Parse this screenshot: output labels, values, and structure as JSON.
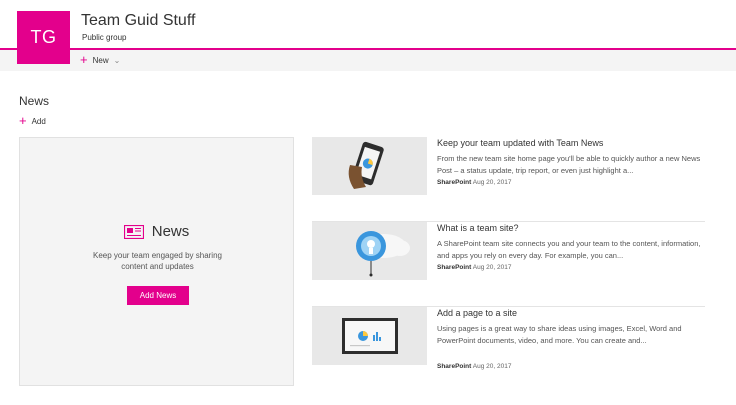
{
  "site": {
    "logo_initials": "TG",
    "title": "Team Guid Stuff",
    "subtitle": "Public group",
    "accent_color": "#e3008c"
  },
  "command_bar": {
    "new_label": "New"
  },
  "news": {
    "heading": "News",
    "add_label": "Add",
    "hero": {
      "icon": "news-icon",
      "title": "News",
      "description": "Keep your team engaged by sharing content and updates",
      "button_label": "Add News"
    },
    "items": [
      {
        "title": "Keep your team updated with Team News",
        "description": "From the new team site home page you'll be able to quickly author a new News Post – a status update, trip report, or even just highlight a...",
        "author": "SharePoint",
        "date": "Aug 20, 2017",
        "thumbnail": "phone-chart-illustration"
      },
      {
        "title": "What is a team site?",
        "description": "A SharePoint team site connects you and your team to the content, information, and apps you rely on every day. For example, you can...",
        "author": "SharePoint",
        "date": "Aug 20, 2017",
        "thumbnail": "lightbulb-cloud-illustration"
      },
      {
        "title": "Add a page to a site",
        "description": "Using pages is a great way to share ideas using images, Excel, Word and PowerPoint documents, video, and more. You can create and...",
        "author": "SharePoint",
        "date": "Aug 20, 2017",
        "thumbnail": "monitor-chart-illustration"
      }
    ]
  }
}
